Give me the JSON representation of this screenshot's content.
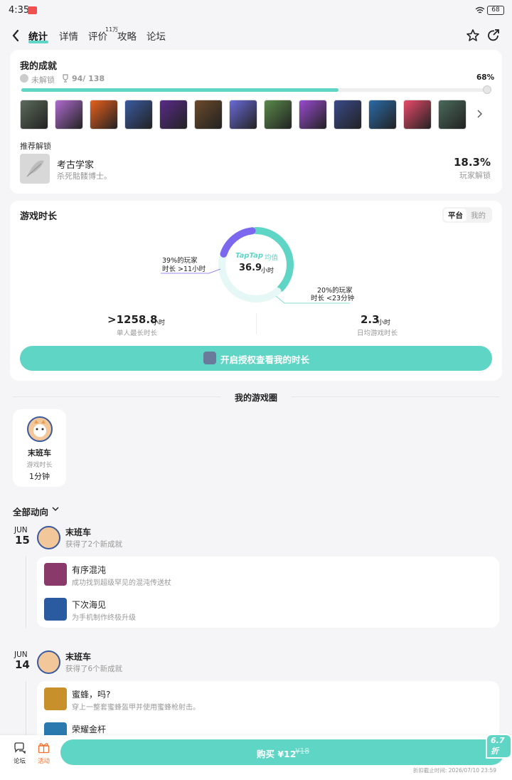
{
  "status": {
    "time": "4:35",
    "battery": "68"
  },
  "nav": {
    "tabs": [
      {
        "label": "统计"
      },
      {
        "label": "详情"
      },
      {
        "label": "评价",
        "badge": "11万"
      },
      {
        "label": "攻略"
      },
      {
        "label": "论坛"
      }
    ]
  },
  "achievements": {
    "title": "我的成就",
    "locked_label": "未解锁",
    "count": "94/ 138",
    "percent_label": "68%",
    "progress": 0.68,
    "tiles": [
      {
        "icon": "tombstone-icon",
        "color": "#5b6b5a"
      },
      {
        "icon": "magic-wand-icon",
        "color": "#b06bd0"
      },
      {
        "icon": "flame-icon",
        "color": "#e8601c"
      },
      {
        "icon": "wizard-gnome-icon",
        "color": "#3a5aa0"
      },
      {
        "icon": "purple-portal-icon",
        "color": "#5a2a8a"
      },
      {
        "icon": "treasure-chest-icon",
        "color": "#6b4a2a"
      },
      {
        "icon": "sky-glow-icon",
        "color": "#6a6ad8"
      },
      {
        "icon": "dresses-icon",
        "color": "#5a8a4a"
      },
      {
        "icon": "purple-slime-icon",
        "color": "#9a4ad0"
      },
      {
        "icon": "pets-icon",
        "color": "#3a4a8a"
      },
      {
        "icon": "fish-skeleton-icon",
        "color": "#2a6aa8"
      },
      {
        "icon": "heart-icon",
        "color": "#e84a6a"
      },
      {
        "icon": "dragon-icon",
        "color": "#4a6a5a"
      }
    ],
    "recommend_title": "推荐解锁",
    "recommend": {
      "name": "考古学家",
      "desc": "杀死骷髅博士。",
      "percent": "18.3%",
      "percent_label": "玩家解锁"
    }
  },
  "playtime": {
    "title": "游戏时长",
    "toggle": {
      "platform": "平台",
      "mine": "我的"
    },
    "donut_brand": "TapTap",
    "donut_avg": "均值",
    "donut_value": "36.9",
    "donut_unit": "小时",
    "left_note_line1": "39%的玩家",
    "left_note_line2": "时长 >11小时",
    "right_note_line1": "20%的玩家",
    "right_note_line2": "时长 <23分钟",
    "stat1_value": ">1258.8",
    "stat1_unit": "小时",
    "stat1_label": "单人最长时长",
    "stat2_value": "2.3",
    "stat2_unit": "小时",
    "stat2_label": "日均游戏时长",
    "cta": "开启授权查看我的时长",
    "segments": {
      "green": 0.39,
      "light": 0.41,
      "purple": 0.2
    }
  },
  "circle": {
    "title": "我的游戏圈",
    "user": {
      "name": "末班车",
      "label": "游戏时长",
      "value": "1分钟"
    }
  },
  "feed": {
    "filter": "全部动向",
    "groups": [
      {
        "month": "JUN",
        "day": "15",
        "user": "末班车",
        "summary": "获得了2个新成就",
        "items": [
          {
            "name": "有序混沌",
            "desc": "成功找到超级罕见的混沌传送杖",
            "icon": "chaos-mask-icon",
            "color": "#8a3a6a"
          },
          {
            "name": "下次海见",
            "desc": "为手机制作终极升级",
            "icon": "cellphone-icon",
            "color": "#2a5aa0"
          }
        ]
      },
      {
        "month": "JUN",
        "day": "14",
        "user": "末班车",
        "summary": "获得了6个新成就",
        "items": [
          {
            "name": "蜜蜂，吗?",
            "desc": "穿上一整套蜜蜂盔甲并使用蜜蜂枪射击。",
            "icon": "bee-icon",
            "color": "#c8902a"
          },
          {
            "name": "荣耀金杆",
            "desc": "",
            "icon": "fishing-rod-icon",
            "color": "#2a7ab0"
          }
        ]
      }
    ]
  },
  "bottom": {
    "forum_label": "论坛",
    "activity_label": "活动",
    "buy_label": "购买 ¥12",
    "old_price": "¥18",
    "discount": "6.7折",
    "deadline": "折扣截止时间: 2026/07/10 23:59"
  },
  "colors": {
    "accent": "#5fd5c5",
    "purple": "#7b68ee",
    "activity": "#f07030"
  }
}
